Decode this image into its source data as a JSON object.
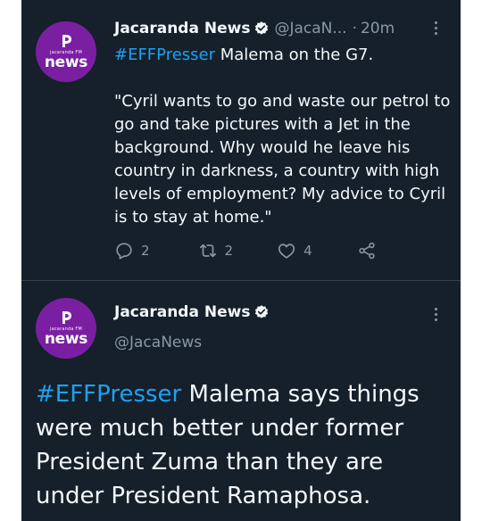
{
  "tweet1": {
    "avatar": {
      "small_text": "jacaranda FM",
      "big_text": "news"
    },
    "name": "Jacaranda News",
    "handle": "@JacaN...",
    "separator": "·",
    "time": "20m",
    "hashtag": "#EFFPresser",
    "text_after_hashtag": " Malema on the G7.",
    "quote": "\"Cyril wants to go and waste our petrol to go and take pictures with a Jet in the background. Why would he leave his country in darkness, a country with high levels of employment? My advice to Cyril is to stay at home.\"",
    "reply_count": "2",
    "retweet_count": "2",
    "like_count": "4"
  },
  "tweet2": {
    "avatar": {
      "small_text": "jacaranda FM",
      "big_text": "news"
    },
    "name": "Jacaranda News",
    "handle": "@JacaNews",
    "hashtag": "#EFFPresser",
    "text_after_hashtag": " Malema says things were much better under former President Zuma than they are under President Ramaphosa."
  },
  "colors": {
    "background": "#15202b",
    "text": "#f5f8fa",
    "secondary": "#8899a6",
    "link": "#1da1f2",
    "avatar": "#7a1fa2"
  }
}
